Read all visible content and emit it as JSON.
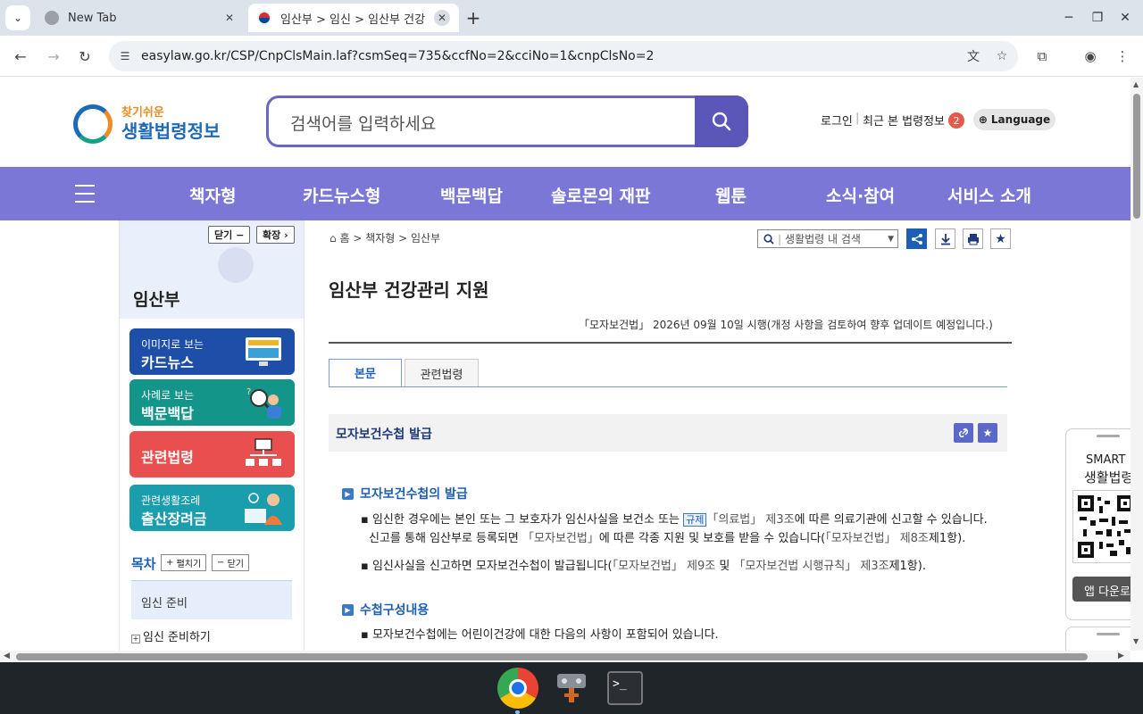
{
  "browser": {
    "tabs": [
      {
        "title": "New Tab"
      },
      {
        "title": "임산부 > 임신 > 임산부 건강"
      }
    ],
    "url": "easylaw.go.kr/CSP/CnpClsMain.laf?csmSeq=735&ccfNo=2&cciNo=1&cnpClsNo=2"
  },
  "header": {
    "logo_line1": "찾기쉬운",
    "logo_line2": "생활법령정보",
    "search_placeholder": "검색어를 입력하세요",
    "login": "로그인",
    "recent": "최근 본 법령정보",
    "recent_count": "2",
    "language": "Language"
  },
  "gnb": {
    "items": [
      "책자형",
      "카드뉴스형",
      "백문백답",
      "솔로몬의 재판",
      "웹툰",
      "소식·참여",
      "서비스 소개"
    ]
  },
  "lnb": {
    "close_btn": "닫기",
    "expand_btn": "확장",
    "title": "임산부",
    "cards": [
      {
        "sub": "이미지로 보는",
        "main": "카드뉴스",
        "color": "#1e4fa8"
      },
      {
        "sub": "사례로 보는",
        "main": "백문백답",
        "color": "#14958a"
      },
      {
        "sub": "",
        "main": "관련법령",
        "color": "#ea4f4f"
      },
      {
        "sub": "관련생활조례",
        "main": "출산장려금",
        "color": "#1a9eae"
      }
    ],
    "toc_title": "목차",
    "toc_expand": "펼치기",
    "toc_collapse": "닫기",
    "toc_items": [
      "임신 준비",
      "임신 준비하기"
    ]
  },
  "content": {
    "breadcrumb": {
      "home": "홈",
      "level1": "책자형",
      "level2": "임산부"
    },
    "inner_search": "생활법령 내 검색",
    "title": "임산부 건강관리 지원",
    "enforcement": "「모자보건법」 2026년 09월 10일 시행(개정 사항을 검토하여 향후 업데이트 예정입니다.)",
    "tabs": [
      "본문",
      "관련법령"
    ],
    "section_title": "모자보건수첩 발급",
    "sub1": "모자보건수첩의 발급",
    "p1_a": "임신한 경우에는 본인 또는 그 보호자가 임신사실을 보건소 또는",
    "p1_tag": "규제",
    "p1_ref": "「의료법」 제3조",
    "p1_b": "에 따른 의료기관에 신고할 수 있습니다.",
    "p2_a": "신고를 통해 임산부로 등록되면",
    "p2_ref1": "「모자보건법」",
    "p2_b": "에 따른 각종 지원 및 보호를 받을 수 있습니다(",
    "p2_ref2": "「모자보건법」 제8조",
    "p2_c": "제1항).",
    "p3_a": "임신사실을 신고하면 모자보건수첩이 발급됩니다(",
    "p3_ref1": "「모자보건법」 제9조",
    "p3_b": " 및 ",
    "p3_ref2": "「모자보건법 시행규칙」 제3조",
    "p3_c": "제1항).",
    "sub2": "수첩구성내용",
    "p4": "모자보건수첩에는 어린이건강에 대한 다음의 사항이 포함되어 있습니다."
  },
  "qr_widget": {
    "line1": "SMART",
    "line2": "생활법령",
    "app_btn": "앱 다운로드"
  }
}
